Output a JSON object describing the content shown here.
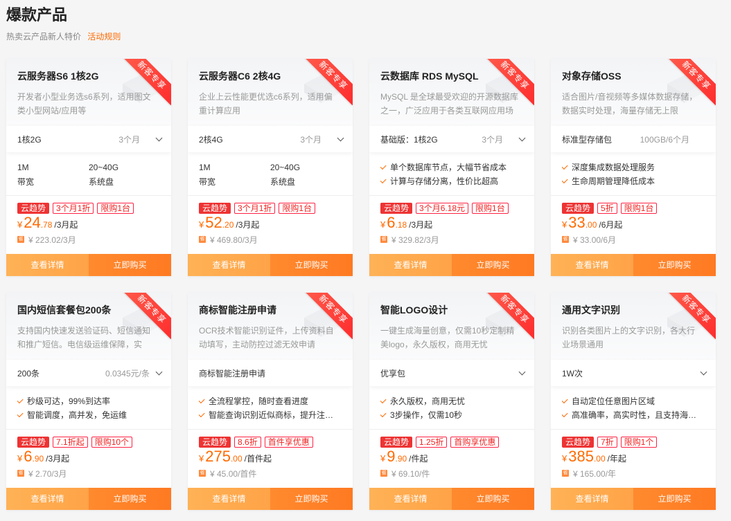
{
  "page": {
    "title": "爆款产品",
    "subtitle": "热卖云产品新人特价",
    "rules_link": "活动规则"
  },
  "colors": {
    "accent": "#ff6a00",
    "tag_red": "#e33333",
    "button_light": "#ffad52",
    "button_dark": "#ff8229"
  },
  "labels": {
    "ribbon": "新客专享",
    "detail": "查看详情",
    "buy": "立即购买",
    "currency": "¥",
    "orig_icon": "省"
  },
  "cards": [
    {
      "title": "云服务器S6 1核2G",
      "desc": "开发者小型业务选s6系列，适用图文类小型网站/应用等",
      "select_value": "1核2G",
      "select_extra": "3个月",
      "has_chevron": true,
      "specs": [
        [
          "1M",
          "带宽"
        ],
        [
          "20~40G",
          "系统盘"
        ]
      ],
      "tags": [
        "云趋势",
        "3个月1折",
        "限购1台"
      ],
      "price_int": "24",
      "price_dec": ".78",
      "price_unit": "/3月起",
      "orig": "¥ 223.02/3月"
    },
    {
      "title": "云服务器C6 2核4G",
      "desc": "企业上云性能更优选c6系列，适用偏重计算应用",
      "select_value": "2核4G",
      "select_extra": "3个月",
      "has_chevron": true,
      "specs": [
        [
          "1M",
          "带宽"
        ],
        [
          "20~40G",
          "系统盘"
        ]
      ],
      "tags": [
        "云趋势",
        "3个月1折",
        "限购1台"
      ],
      "price_int": "52",
      "price_dec": ".20",
      "price_unit": "/3月起",
      "orig": "¥ 469.80/3月"
    },
    {
      "title": "云数据库 RDS MySQL",
      "desc": "MySQL 是全球最受欢迎的开源数据库之一，广泛应用于各类互联网应用场景",
      "select_value": "基础版：1核2G",
      "select_extra": "3个月",
      "has_chevron": true,
      "features": [
        "单个数据库节点，大幅节省成本",
        "计算与存储分离，性价比超高"
      ],
      "tags": [
        "云趋势",
        "3个月6.18元",
        "限购1台"
      ],
      "price_int": "6",
      "price_dec": ".18",
      "price_unit": "/3月起",
      "orig": "¥ 329.82/3月"
    },
    {
      "title": "对象存储OSS",
      "desc": "适合图片/音视频等多媒体数据存储，数据实时处理，海量存储无上限",
      "select_value": "标准型存储包",
      "select_extra": "100GB/6个月",
      "has_chevron": false,
      "features": [
        "深度集成数据处理服务",
        "生命周期管理降低成本"
      ],
      "tags": [
        "云趋势",
        "5折",
        "限购1台"
      ],
      "price_int": "33",
      "price_dec": ".00",
      "price_unit": "/6月起",
      "orig": "¥ 33.00/6月"
    },
    {
      "title": "国内短信套餐包200条",
      "desc": "支持国内快速发送验证码、短信通知和推广短信。电信级运维保障，实时…",
      "select_value": "200条",
      "select_extra": "0.0345元/条",
      "has_chevron": true,
      "features": [
        "秒级可达，99%到达率",
        "智能调度，高并发，免运维"
      ],
      "tags": [
        "云趋势",
        "7.1折起",
        "限购10个"
      ],
      "price_int": "6",
      "price_dec": ".90",
      "price_unit": "/3月起",
      "orig": "¥ 2.70/3月"
    },
    {
      "title": "商标智能注册申请",
      "desc": "OCR技术智能识别证件，上传资料自动填写，主动防控过滤无效申请",
      "select_value": "商标智能注册申请",
      "select_extra": "",
      "has_chevron": false,
      "features": [
        "全流程掌控，随时查看进度",
        "智能查询识别近似商标，提升注…"
      ],
      "tags": [
        "云趋势",
        "8.6折",
        "首件享优惠"
      ],
      "price_int": "275",
      "price_dec": ".00",
      "price_unit": "/首件起",
      "orig": "¥ 45.00/首件"
    },
    {
      "title": "智能LOGO设计",
      "desc": "一键生成海量创意，仅需10秒定制精美logo，永久版权，商用无忧",
      "select_value": "优享包",
      "select_extra": "",
      "has_chevron": true,
      "features": [
        "永久版权，商用无忧",
        "3步操作，仅需10秒"
      ],
      "tags": [
        "云趋势",
        "1.25折",
        "首购享优惠"
      ],
      "price_int": "9",
      "price_dec": ".90",
      "price_unit": "/件起",
      "orig": "¥ 69.10/件"
    },
    {
      "title": "通用文字识别",
      "desc": "识别各类图片上的文字识别，各大行业场景通用",
      "select_value": "1W次",
      "select_extra": "",
      "has_chevron": true,
      "features": [
        "自动定位任意图片区域",
        "高准确率，高实时性，且支持海…"
      ],
      "tags": [
        "云趋势",
        "7折",
        "限购1个"
      ],
      "price_int": "385",
      "price_dec": ".00",
      "price_unit": "/年起",
      "orig": "¥ 165.00/年"
    }
  ]
}
